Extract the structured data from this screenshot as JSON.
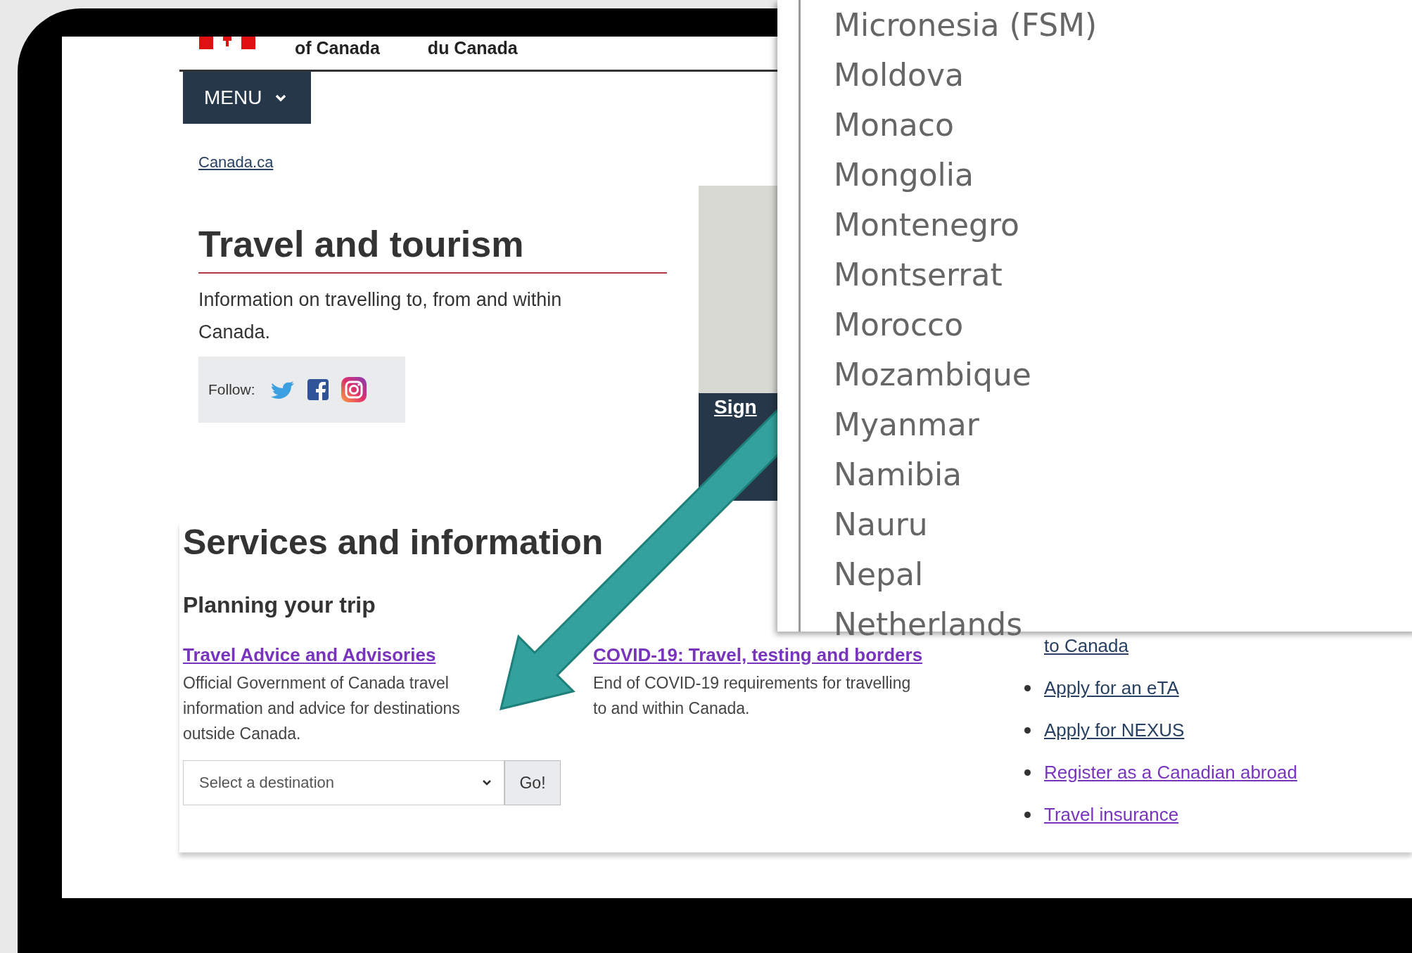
{
  "header": {
    "english_name": "of Canada",
    "french_name": "du Canada"
  },
  "menu_button": {
    "label": "MENU"
  },
  "breadcrumb": "Canada.ca",
  "title": "Travel and tourism",
  "intro": "Information on travelling to, from and within Canada.",
  "follow": {
    "label": "Follow:"
  },
  "promo": {
    "text": "Sign"
  },
  "services": {
    "heading": "Services and information",
    "subheading": "Planning your trip",
    "columns": [
      {
        "link": "Travel Advice and Advisories",
        "visited": true,
        "description": "Official Government of Canada travel information and advice for destinations outside Canada.",
        "select": {
          "placeholder": "Select a destination",
          "button": "Go!"
        }
      },
      {
        "link": "COVID-19: Travel, testing and borders",
        "visited": true,
        "description": "End of COVID-19 requirements for travelling to and within Canada."
      }
    ],
    "links": [
      {
        "text": "to Canada",
        "kind": "continuation",
        "visited": false
      },
      {
        "text": "Apply for an eTA",
        "kind": "item",
        "visited": false
      },
      {
        "text": "Apply for NEXUS",
        "kind": "item",
        "visited": false
      },
      {
        "text": "Register as a Canadian abroad",
        "kind": "item",
        "visited": true
      },
      {
        "text": "Travel insurance",
        "kind": "item",
        "visited": true
      }
    ]
  },
  "destination_list": [
    "Micronesia (FSM)",
    "Moldova",
    "Monaco",
    "Mongolia",
    "Montenegro",
    "Montserrat",
    "Morocco",
    "Mozambique",
    "Myanmar",
    "Namibia",
    "Nauru",
    "Nepal",
    "Netherlands"
  ]
}
